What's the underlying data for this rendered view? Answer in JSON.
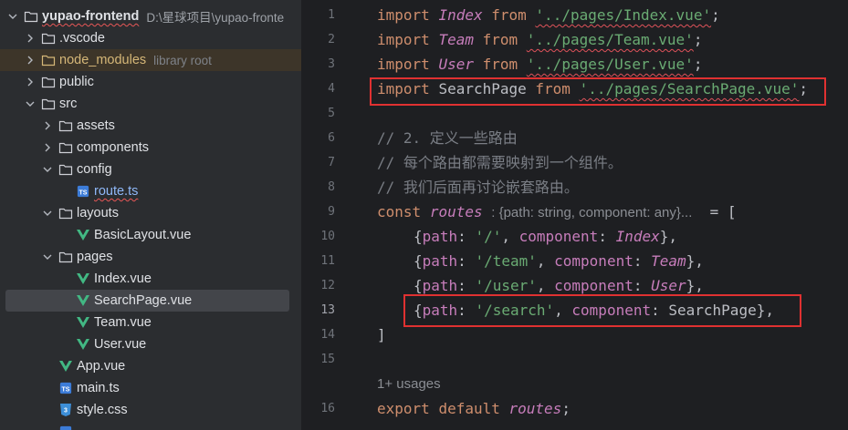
{
  "project_tree": {
    "root": {
      "name": "yupao-frontend",
      "path": "D:\\星球项目\\yupao-fronte"
    },
    "items": [
      {
        "label": ".vscode"
      },
      {
        "label": "node_modules",
        "note": "library root"
      },
      {
        "label": "public"
      },
      {
        "label": "src"
      },
      {
        "label": "assets"
      },
      {
        "label": "components"
      },
      {
        "label": "config"
      },
      {
        "label": "route.ts"
      },
      {
        "label": "layouts"
      },
      {
        "label": "BasicLayout.vue"
      },
      {
        "label": "pages"
      },
      {
        "label": "Index.vue"
      },
      {
        "label": "SearchPage.vue"
      },
      {
        "label": "Team.vue"
      },
      {
        "label": "User.vue"
      },
      {
        "label": "App.vue"
      },
      {
        "label": "main.ts"
      },
      {
        "label": "style.css"
      }
    ]
  },
  "editor": {
    "line_numbers": [
      "1",
      "2",
      "3",
      "4",
      "5",
      "6",
      "7",
      "8",
      "9",
      "10",
      "11",
      "12",
      "13",
      "14",
      "15",
      "16"
    ],
    "lines": {
      "l1": {
        "kw_import": "import",
        "name": "Index",
        "kw_from": "from",
        "path": "'../pages/Index.vue'",
        "end": ";"
      },
      "l2": {
        "kw_import": "import",
        "name": "Team",
        "kw_from": "from",
        "path": "'../pages/Team.vue'",
        "end": ";"
      },
      "l3": {
        "kw_import": "import",
        "name": "User",
        "kw_from": "from",
        "path": "'../pages/User.vue'",
        "end": ";"
      },
      "l4": {
        "kw_import": "import",
        "name": "SearchPage",
        "kw_from": "from",
        "path": "'../pages/SearchPage.vue'",
        "end": ";"
      },
      "l6": "// 2. 定义一些路由",
      "l7": "// 每个路由都需要映射到一个组件。",
      "l8": "// 我们后面再讨论嵌套路由。",
      "l9": {
        "kw_const": "const",
        "name": "routes",
        "type_hint": ": {path: string, component: any}...",
        "rest": "= ["
      },
      "l10": {
        "open": "{",
        "path_key": "path",
        "colon1": ": ",
        "path_val": "'/'",
        "comma1": ", ",
        "comp_key": "component",
        "colon2": ": ",
        "comp_val": "Index",
        "close": "},"
      },
      "l11": {
        "open": "{",
        "path_key": "path",
        "colon1": ": ",
        "path_val": "'/team'",
        "comma1": ", ",
        "comp_key": "component",
        "colon2": ": ",
        "comp_val": "Team",
        "close": "},"
      },
      "l12": {
        "open": "{",
        "path_key": "path",
        "colon1": ": ",
        "path_val": "'/user'",
        "comma1": ", ",
        "comp_key": "component",
        "colon2": ": ",
        "comp_val": "User",
        "close": "},"
      },
      "l13": {
        "open": "{",
        "path_key": "path",
        "colon1": ": ",
        "path_val": "'/search'",
        "comma1": ", ",
        "comp_key": "component",
        "colon2": ": ",
        "comp_val": "SearchPage",
        "close": "},"
      },
      "l14": "]",
      "usages": "1+ usages",
      "l16": {
        "kw_export": "export",
        "kw_default": "default",
        "name": "routes",
        "end": ";"
      }
    }
  },
  "colors": {
    "tree_bg": "#2b2d30",
    "editor_bg": "#1e1f22",
    "keyword": "#cf8e6d",
    "string": "#6aab73",
    "highlight_box": "#e03131",
    "vue_icon": "#42b883",
    "ts_icon": "#3c7cd8"
  },
  "icons": [
    "chevron-down-icon",
    "chevron-right-icon",
    "folder-icon",
    "vue-file-icon",
    "ts-file-icon",
    "css-file-icon",
    "lightbulb-icon"
  ]
}
